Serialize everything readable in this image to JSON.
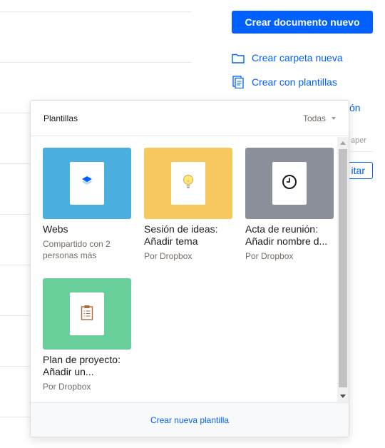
{
  "header": {
    "primary_button": "Crear documento nuevo"
  },
  "side_actions": [
    {
      "label": "Crear carpeta nueva",
      "icon": "folder-icon"
    },
    {
      "label": "Crear con plantillas",
      "icon": "template-doc-icon"
    }
  ],
  "background_fragments": {
    "link_tail": "ón",
    "meta_tail": "aper",
    "button_tail": "itar"
  },
  "templates_popover": {
    "title": "Plantillas",
    "filter": "Todas",
    "footer_link": "Crear nueva plantilla",
    "cards": [
      {
        "name": "Webs",
        "subtitle": "Compartido con 2 personas más",
        "color": "#4aafde",
        "icon": "layers-icon"
      },
      {
        "name": "Sesión de ideas: Añadir tema",
        "subtitle": "Por Dropbox",
        "color": "#f6c95e",
        "icon": "lightbulb-icon"
      },
      {
        "name": "Acta de reunión: Añadir nombre d...",
        "subtitle": "Por Dropbox",
        "color": "#8a8f99",
        "icon": "clock-icon"
      },
      {
        "name": "Plan de proyecto: Añadir un...",
        "subtitle": "Por Dropbox",
        "color": "#68cf9b",
        "icon": "clipboard-icon"
      }
    ]
  }
}
